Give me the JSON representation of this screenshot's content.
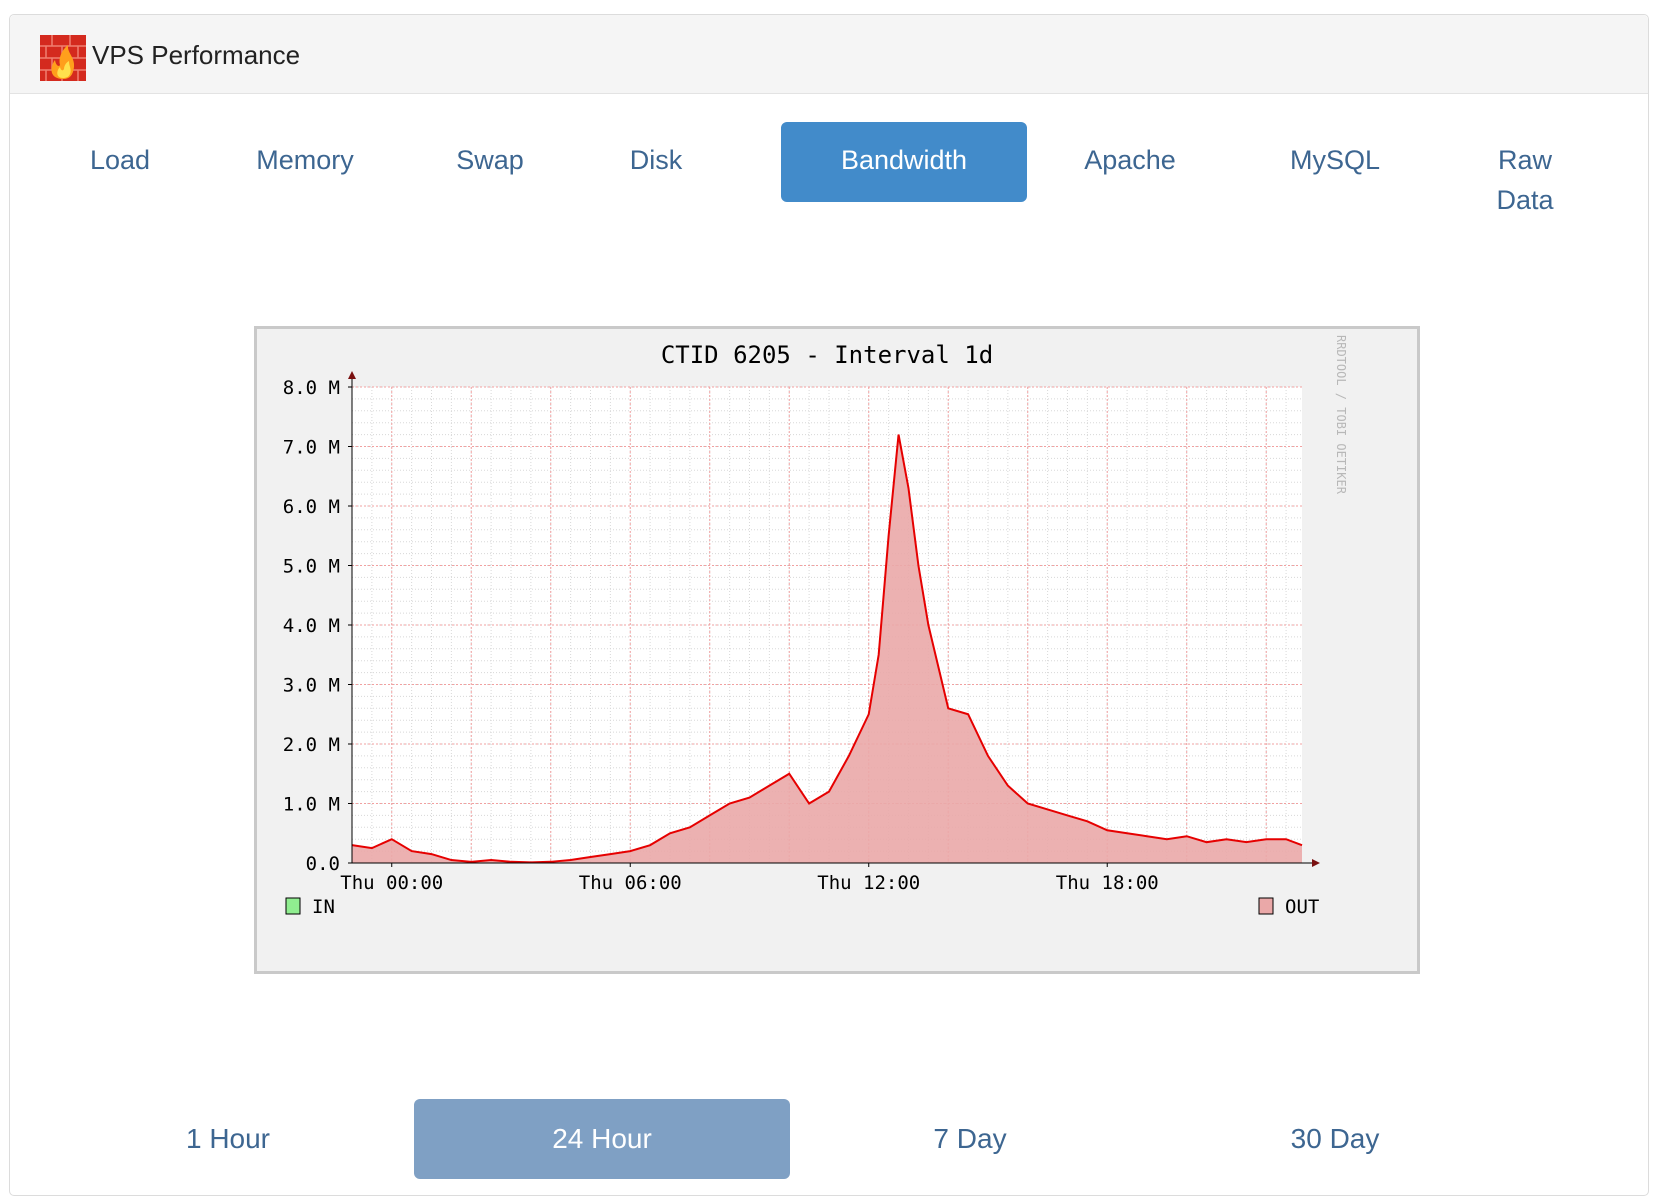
{
  "header": {
    "title": "VPS Performance",
    "logo_icon": "flame-wall-icon"
  },
  "tabs": [
    {
      "label": "Load",
      "active": false
    },
    {
      "label": "Memory",
      "active": false
    },
    {
      "label": "Swap",
      "active": false
    },
    {
      "label": "Disk",
      "active": false
    },
    {
      "label": "Bandwidth",
      "active": true
    },
    {
      "label": "Apache",
      "active": false
    },
    {
      "label": "MySQL",
      "active": false
    },
    {
      "label": "Raw Data",
      "active": false
    }
  ],
  "ranges": [
    {
      "label": "1 Hour",
      "active": false
    },
    {
      "label": "24 Hour",
      "active": true
    },
    {
      "label": "7 Day",
      "active": false
    },
    {
      "label": "30 Day",
      "active": false
    }
  ],
  "colors": {
    "accent": "#428bca",
    "link": "#3d6691",
    "range_active": "#7fa0c4",
    "out_line": "#e60000",
    "out_fill": "#eaa8a8",
    "in_fill": "#90ee90"
  },
  "chart_data": {
    "type": "area",
    "title": "CTID 6205 - Interval 1d",
    "watermark": "RRDTOOL / TOBI OETIKER",
    "y_unit": "M",
    "ylim": [
      0,
      8
    ],
    "yticks": [
      "0.0",
      "1.0 M",
      "2.0 M",
      "3.0 M",
      "4.0 M",
      "5.0 M",
      "6.0 M",
      "7.0 M",
      "8.0 M"
    ],
    "xlim": [
      -1,
      22.9
    ],
    "xticks": [
      {
        "label": "Thu 00:00",
        "hour": 0
      },
      {
        "label": "Thu 06:00",
        "hour": 6
      },
      {
        "label": "Thu 12:00",
        "hour": 12
      },
      {
        "label": "Thu 18:00",
        "hour": 18
      }
    ],
    "grid": true,
    "legend": [
      {
        "name": "IN",
        "position": "bottom-left"
      },
      {
        "name": "OUT",
        "position": "bottom-right"
      }
    ],
    "series": [
      {
        "name": "OUT",
        "x": [
          -1,
          -0.5,
          0,
          0.5,
          1,
          1.5,
          2,
          2.5,
          3,
          3.5,
          4,
          4.5,
          5,
          5.5,
          6,
          6.5,
          7,
          7.5,
          8,
          8.5,
          9,
          9.5,
          10,
          10.5,
          11,
          11.5,
          12,
          12.25,
          12.5,
          12.75,
          13,
          13.25,
          13.5,
          13.75,
          14,
          14.5,
          15,
          15.5,
          16,
          16.5,
          17,
          17.5,
          18,
          18.5,
          19,
          19.5,
          20,
          20.5,
          21,
          21.5,
          22,
          22.5,
          22.9
        ],
        "values": [
          0.3,
          0.25,
          0.4,
          0.2,
          0.15,
          0.05,
          0.02,
          0.05,
          0.02,
          0.01,
          0.02,
          0.05,
          0.1,
          0.15,
          0.2,
          0.3,
          0.5,
          0.6,
          0.8,
          1.0,
          1.1,
          1.3,
          1.5,
          1.0,
          1.2,
          1.8,
          2.5,
          3.5,
          5.5,
          7.2,
          6.3,
          5.0,
          4.0,
          3.3,
          2.6,
          2.5,
          1.8,
          1.3,
          1.0,
          0.9,
          0.8,
          0.7,
          0.55,
          0.5,
          0.45,
          0.4,
          0.45,
          0.35,
          0.4,
          0.35,
          0.4,
          0.4,
          0.3
        ]
      },
      {
        "name": "IN",
        "x": [
          -1,
          22.9
        ],
        "values": [
          0.0,
          0.0
        ]
      }
    ]
  }
}
